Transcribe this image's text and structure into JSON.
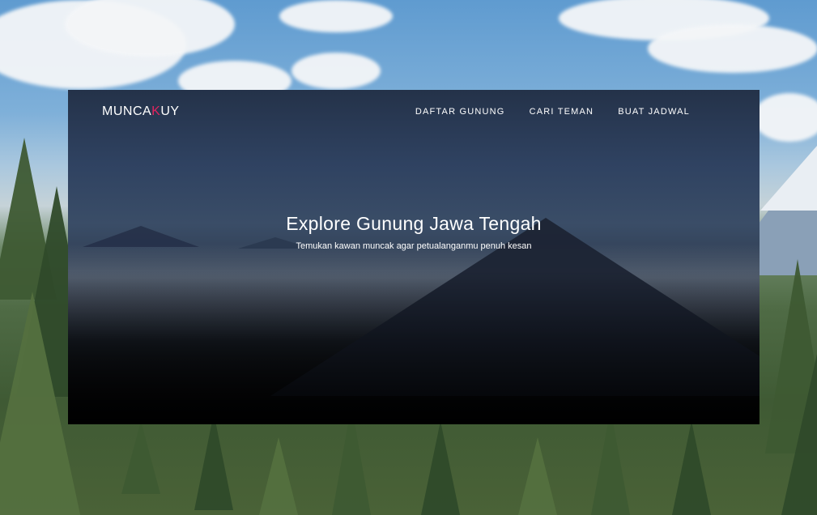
{
  "brand": {
    "prefix": "MUNCA",
    "accent": "K",
    "suffix": "UY",
    "accent_color": "#e0245e"
  },
  "nav": {
    "items": [
      {
        "label": "DAFTAR GUNUNG"
      },
      {
        "label": "CARI TEMAN"
      },
      {
        "label": "BUAT JADWAL"
      }
    ]
  },
  "hero": {
    "title": "Explore Gunung Jawa Tengah",
    "subtitle": "Temukan kawan muncak agar petualanganmu penuh kesan"
  },
  "colors": {
    "text": "#ffffff",
    "hero_dark": "#050506",
    "hero_blue": "#2f4261"
  }
}
